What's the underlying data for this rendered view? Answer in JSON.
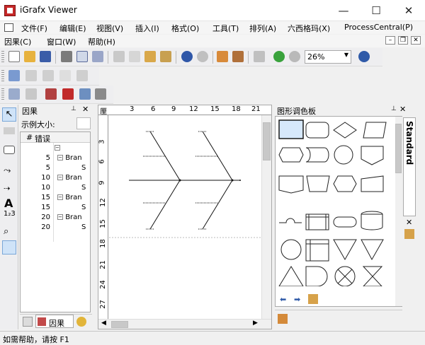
{
  "window": {
    "title": "iGrafx Viewer",
    "minimize": "—",
    "maximize": "☐",
    "close": "✕"
  },
  "menu": {
    "row1": [
      "文件(F)",
      "编辑(E)",
      "视图(V)",
      "插入(I)",
      "格式(O)",
      "工具(T)",
      "排列(A)",
      "六西格玛(X)",
      "ProcessCentral(P)"
    ],
    "row2": [
      "因果(C)",
      "窗口(W)",
      "帮助(H)"
    ]
  },
  "toolbar": {
    "zoom_value": "26%"
  },
  "cause_panel": {
    "title": "因果",
    "sample_size_label": "示例大小:",
    "sample_size_value": "",
    "column_hash": "#",
    "column_error": "错误",
    "rows": [
      {
        "num": "",
        "label": ""
      },
      {
        "num": "5",
        "label": "Bran"
      },
      {
        "num": "5",
        "label": "S"
      },
      {
        "num": "10",
        "label": "Bran"
      },
      {
        "num": "10",
        "label": "S"
      },
      {
        "num": "15",
        "label": "Bran"
      },
      {
        "num": "15",
        "label": "S"
      },
      {
        "num": "20",
        "label": "Bran"
      },
      {
        "num": "20",
        "label": "S"
      }
    ],
    "tab_label": "因果"
  },
  "ruler": {
    "h_ticks": [
      "厘",
      "3",
      "6",
      "9",
      "12",
      "15",
      "18",
      "21"
    ],
    "v_ticks": [
      "3",
      "6",
      "9",
      "12",
      "15",
      "18",
      "21",
      "24",
      "27"
    ]
  },
  "palette": {
    "title": "图形调色板",
    "side_tab": "Standard"
  },
  "status": {
    "text": "如需帮助，请按 F1"
  }
}
